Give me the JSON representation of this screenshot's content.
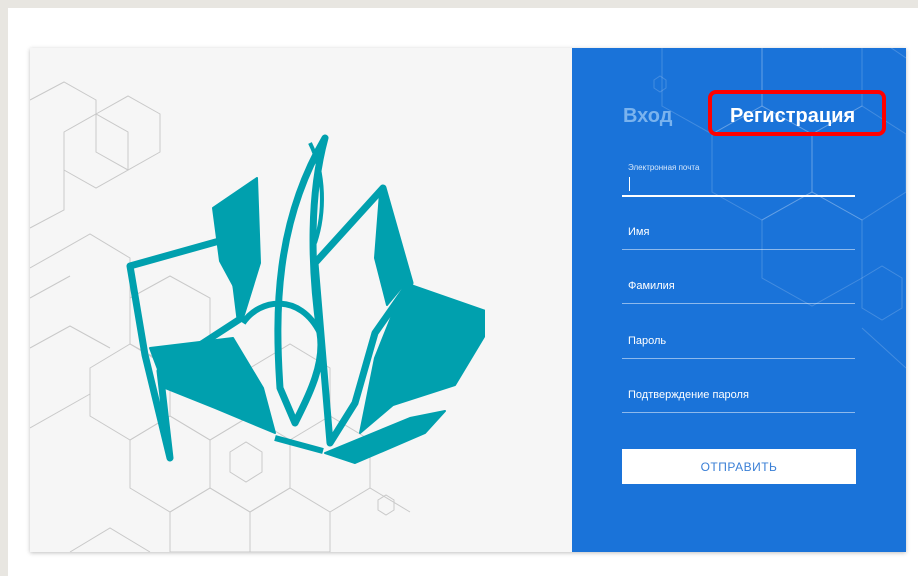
{
  "tabs": {
    "login_label": "Вход",
    "register_label": "Регистрация"
  },
  "form": {
    "fields": [
      {
        "label": "Электронная почта",
        "value": ""
      },
      {
        "label": "Имя",
        "value": ""
      },
      {
        "label": "Фамилия",
        "value": ""
      },
      {
        "label": "Пароль",
        "value": ""
      },
      {
        "label": "Подтверждение пароля",
        "value": ""
      }
    ],
    "submit_label": "ОТПРАВИТЬ"
  },
  "colors": {
    "panel_blue": "#1a73d9",
    "logo_teal": "#00a0ae",
    "highlight_red": "#ff0000",
    "inactive_tab": "#7ab3ee"
  },
  "icons": {
    "logo": "open-book-flame-logo"
  }
}
